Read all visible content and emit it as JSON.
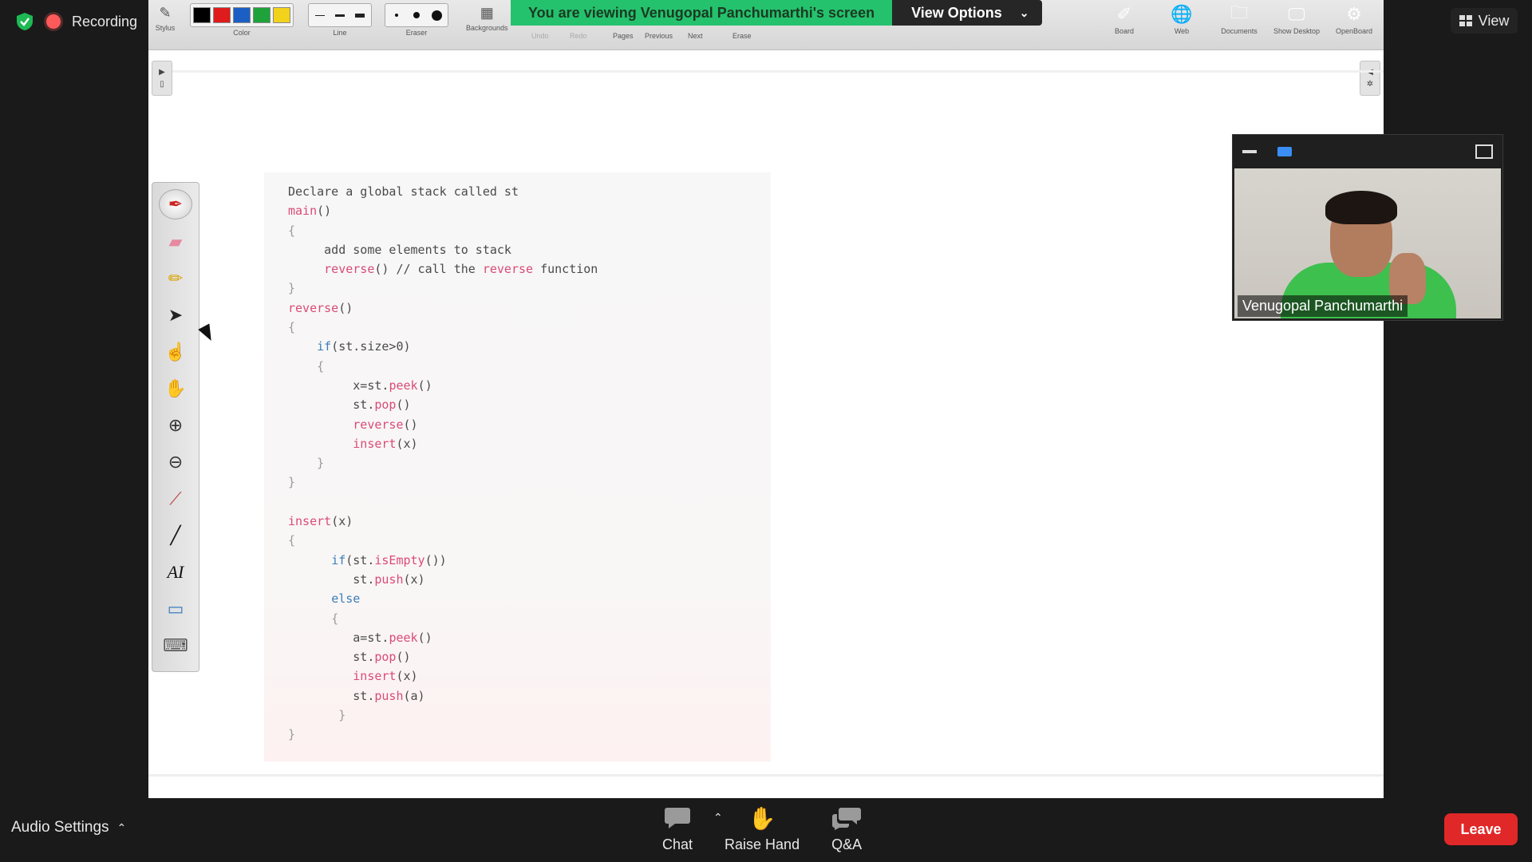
{
  "status": {
    "recording_label": "Recording",
    "view_label": "View"
  },
  "banner": {
    "text": "You are viewing Venugopal Panchumarthi's screen",
    "view_options": "View Options"
  },
  "toolbar": {
    "stylus": "Stylus",
    "color": "Color",
    "line": "Line",
    "eraser": "Eraser",
    "backgrounds": "Backgrounds",
    "undo": "Undo",
    "redo": "Redo",
    "pages": "Pages",
    "previous": "Previous",
    "next": "Next",
    "erase": "Erase",
    "board": "Board",
    "web": "Web",
    "documents": "Documents",
    "show_desktop": "Show Desktop",
    "openboard": "OpenBoard",
    "colors": [
      "#000000",
      "#e01b1b",
      "#1c5fc4",
      "#1ea33a",
      "#f3d21b"
    ]
  },
  "code": {
    "lines": [
      "Declare a global stack called st",
      "main()",
      "{",
      "     add some elements to stack",
      "     reverse() // call the reverse function",
      "}",
      "reverse()",
      "{",
      "    if(st.size>0)",
      "    {",
      "         x=st.peek()",
      "         st.pop()",
      "         reverse()",
      "         insert(x)",
      "    }",
      "}",
      "",
      "insert(x)",
      "{",
      "      if(st.isEmpty())",
      "         st.push(x)",
      "      else",
      "      {",
      "         a=st.peek()",
      "         st.pop()",
      "         insert(x)",
      "         st.push(a)",
      "       }",
      "}"
    ]
  },
  "video": {
    "name": "Venugopal Panchumarthi"
  },
  "bottom": {
    "audio": "Audio Settings",
    "chat": "Chat",
    "raise_hand": "Raise Hand",
    "qa": "Q&A",
    "leave": "Leave"
  }
}
